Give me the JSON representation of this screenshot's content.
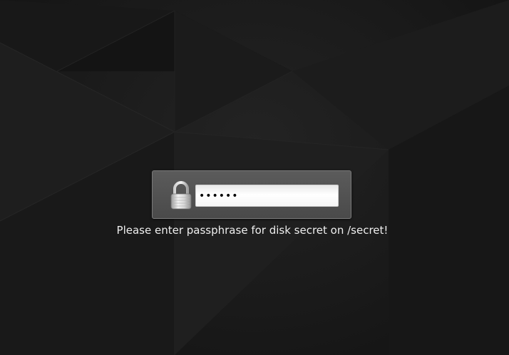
{
  "prompt": {
    "password_value": "••••••",
    "lock_icon": "padlock-icon",
    "message": "Please enter passphrase for disk secret on /secret!"
  }
}
